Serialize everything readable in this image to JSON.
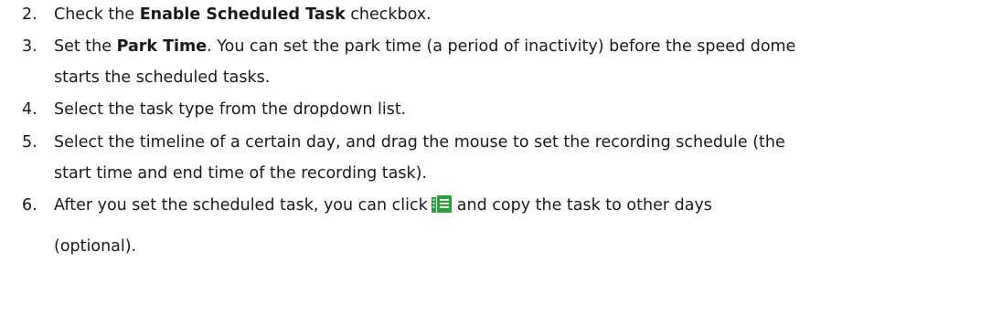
{
  "steps": [
    {
      "number": "2.",
      "pre": "Check the ",
      "bold": "Enable Scheduled Task",
      "post": " checkbox."
    },
    {
      "number": "3.",
      "pre": "Set the ",
      "bold": "Park Time",
      "post": ". You can set the park time (a period of inactivity) before the speed dome",
      "line2": "starts the scheduled tasks."
    },
    {
      "number": "4.",
      "text": "Select the task type from the dropdown list."
    },
    {
      "number": "5.",
      "line1": "Select the timeline of a certain day, and drag the mouse to set the recording schedule (the",
      "line2": "start time and end time of the recording task)."
    },
    {
      "number": "6.",
      "pre": "After you set the scheduled task, you can click",
      "icon": "copy-to-days-icon",
      "icon_color": "#2e9e3a",
      "post": "and copy the task to other days",
      "line2": "(optional)."
    }
  ]
}
